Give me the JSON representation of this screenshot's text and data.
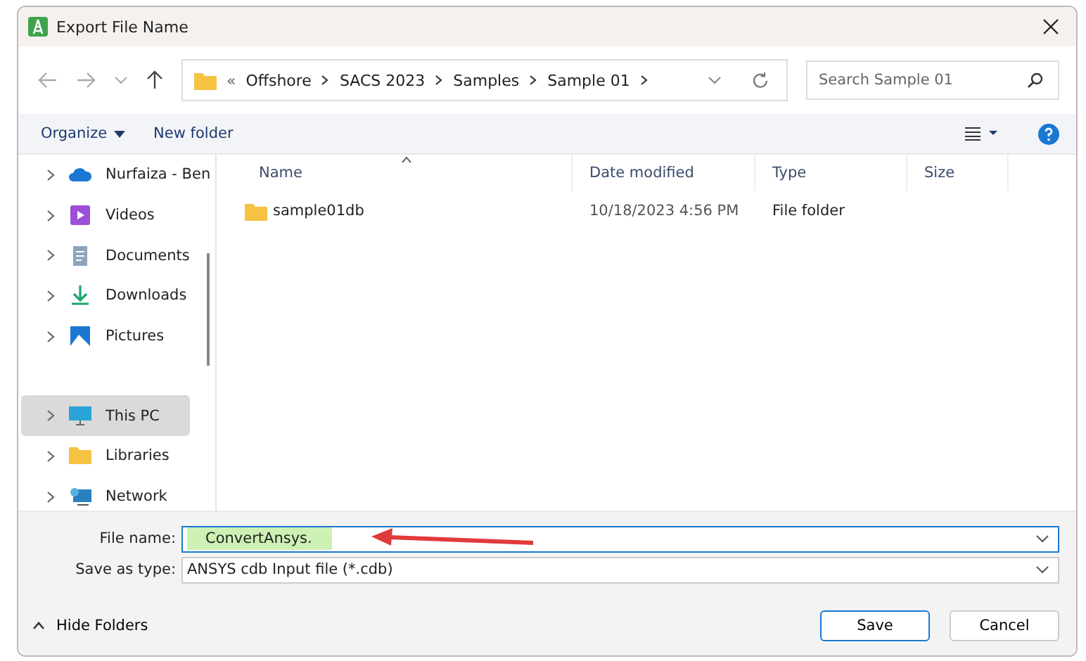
{
  "window": {
    "title": "Export File Name"
  },
  "address_bar": {
    "overflow": "«",
    "crumbs": [
      "Offshore",
      "SACS 2023",
      "Samples",
      "Sample 01"
    ]
  },
  "search": {
    "placeholder": "Search Sample 01"
  },
  "toolbar": {
    "organize": "Organize",
    "new_folder": "New folder"
  },
  "sidebar": {
    "items": [
      {
        "label": "Nurfaiza - Ben",
        "kind": "cloud",
        "selected": false
      },
      {
        "label": "Videos",
        "kind": "videos",
        "selected": false
      },
      {
        "label": "Documents",
        "kind": "documents",
        "selected": false
      },
      {
        "label": "Downloads",
        "kind": "downloads",
        "selected": false
      },
      {
        "label": "Pictures",
        "kind": "pictures",
        "selected": false
      },
      {
        "label": "This PC",
        "kind": "pc",
        "selected": true
      },
      {
        "label": "Libraries",
        "kind": "libraries",
        "selected": false
      },
      {
        "label": "Network",
        "kind": "network",
        "selected": false
      }
    ]
  },
  "table": {
    "columns": [
      "Name",
      "Date modified",
      "Type",
      "Size"
    ],
    "rows": [
      {
        "name": "sample01db",
        "date": "10/18/2023 4:56 PM",
        "type": "File folder"
      }
    ]
  },
  "file_name": {
    "label": "File name:",
    "value": "ConvertAnsys."
  },
  "save_as_type": {
    "label": "Save as type:",
    "value": "ANSYS cdb Input file (*.cdb)"
  },
  "footer": {
    "hide_folders": "Hide Folders",
    "buttons": [
      "Save",
      "Cancel"
    ]
  }
}
